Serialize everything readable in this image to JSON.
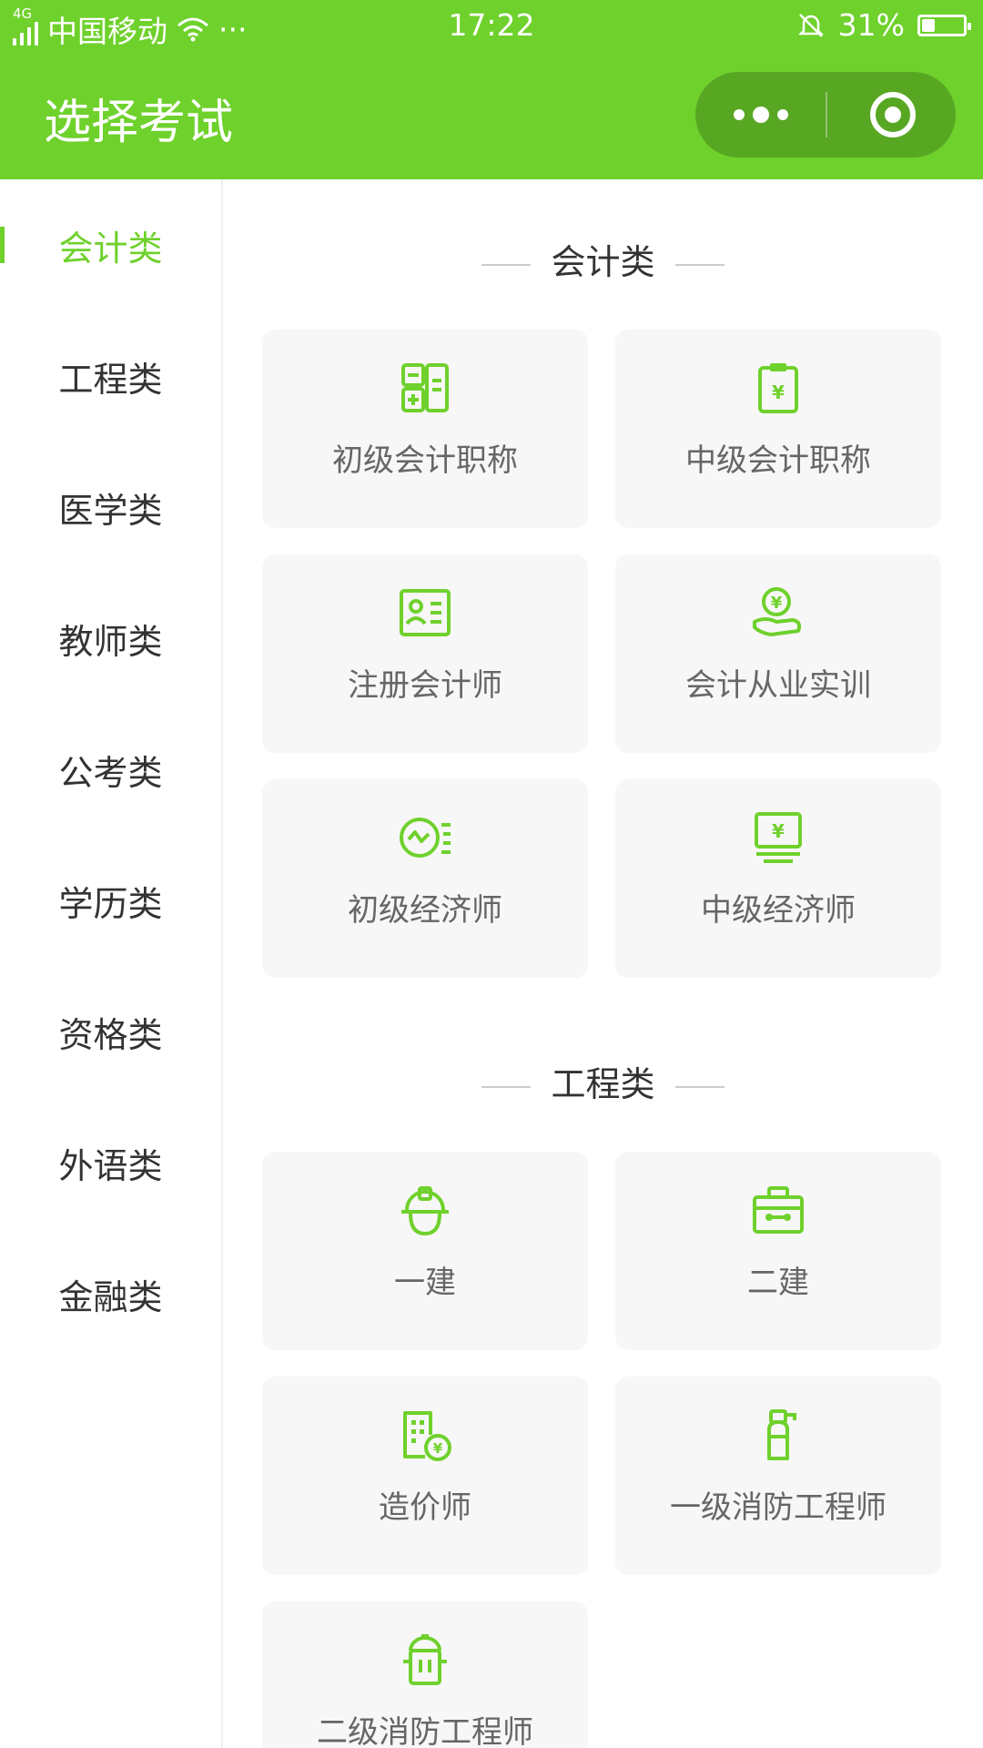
{
  "status_bar": {
    "network": "4G",
    "carrier": "中国移动",
    "more": "···",
    "time": "17:22",
    "battery_percent": "31%",
    "battery_level": 0.31
  },
  "header": {
    "title": "选择考试"
  },
  "sidebar": {
    "items": [
      {
        "label": "会计类",
        "active": true
      },
      {
        "label": "工程类"
      },
      {
        "label": "医学类"
      },
      {
        "label": "教师类"
      },
      {
        "label": "公考类"
      },
      {
        "label": "学历类"
      },
      {
        "label": "资格类"
      },
      {
        "label": "外语类"
      },
      {
        "label": "金融类"
      }
    ]
  },
  "sections": [
    {
      "title": "会计类",
      "cards": [
        {
          "label": "初级会计职称",
          "icon": "calculator-icon"
        },
        {
          "label": "中级会计职称",
          "icon": "clipboard-yen-icon"
        },
        {
          "label": "注册会计师",
          "icon": "id-card-icon"
        },
        {
          "label": "会计从业实训",
          "icon": "hand-coin-icon"
        },
        {
          "label": "初级经济师",
          "icon": "wave-chart-icon"
        },
        {
          "label": "中级经济师",
          "icon": "monitor-yen-icon"
        }
      ]
    },
    {
      "title": "工程类",
      "cards": [
        {
          "label": "一建",
          "icon": "helmet-icon"
        },
        {
          "label": "二建",
          "icon": "toolbox-icon"
        },
        {
          "label": "造价师",
          "icon": "building-yen-icon"
        },
        {
          "label": "一级消防工程师",
          "icon": "extinguisher-icon"
        },
        {
          "label": "二级消防工程师",
          "icon": "hydrant-icon"
        }
      ]
    }
  ],
  "colors": {
    "accent": "#6fd12c",
    "card_bg": "#f7f7f7",
    "text": "#333333",
    "label": "#666666"
  }
}
